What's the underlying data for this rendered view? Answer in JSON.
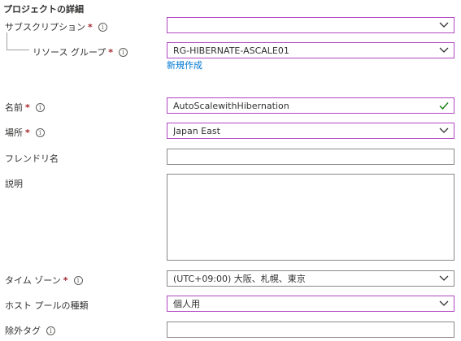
{
  "section_title": "プロジェクトの詳細",
  "subscription": {
    "label": "サブスクリプション",
    "required": "*",
    "value": ""
  },
  "resource_group": {
    "label": "リソース グループ",
    "required": "*",
    "value": "RG-HIBERNATE-ASCALE01",
    "create_new": "新規作成"
  },
  "name": {
    "label": "名前",
    "required": "*",
    "value": "AutoScalewithHibernation"
  },
  "location": {
    "label": "場所",
    "required": "*",
    "value": "Japan East"
  },
  "friendly_name": {
    "label": "フレンドリ名",
    "value": ""
  },
  "description": {
    "label": "説明",
    "value": ""
  },
  "timezone": {
    "label": "タイム ゾーン",
    "required": "*",
    "value": "(UTC+09:00) 大阪、札幌、東京"
  },
  "host_pool_type": {
    "label": "ホスト プールの種類",
    "value": "個人用"
  },
  "exclusion_tag": {
    "label": "除外タグ",
    "value": ""
  },
  "colors": {
    "accent": "#b146c2",
    "required": "#a4262c",
    "link": "#0078d4",
    "valid": "#107c10"
  }
}
